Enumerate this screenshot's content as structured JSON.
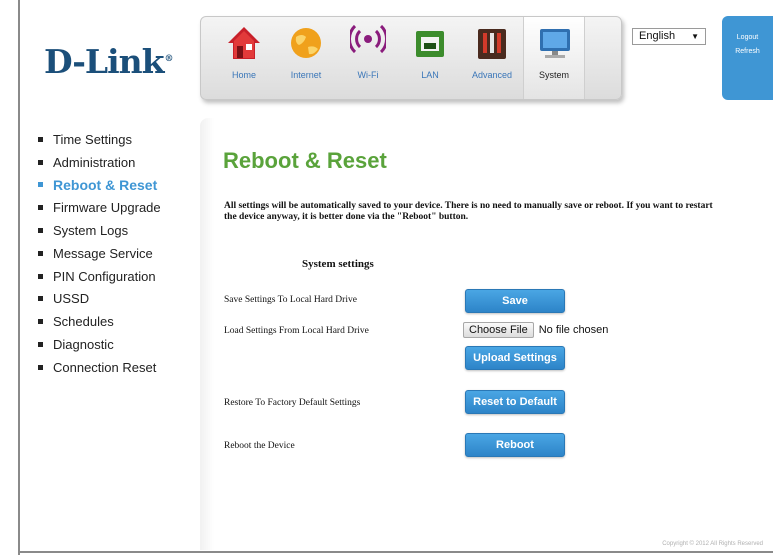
{
  "brand": {
    "logo_text": "D-Link",
    "registered": "®"
  },
  "nav": {
    "items": [
      {
        "label": "Home",
        "icon": "home-icon"
      },
      {
        "label": "Internet",
        "icon": "globe-icon"
      },
      {
        "label": "Wi-Fi",
        "icon": "wifi-icon"
      },
      {
        "label": "LAN",
        "icon": "lan-icon"
      },
      {
        "label": "Advanced",
        "icon": "tools-icon"
      },
      {
        "label": "System",
        "icon": "computer-icon"
      }
    ],
    "active": "System"
  },
  "language": {
    "selected": "English"
  },
  "account": {
    "logout": "Logout",
    "refresh": "Refresh"
  },
  "sidebar": {
    "items": [
      {
        "label": "Time Settings"
      },
      {
        "label": "Administration"
      },
      {
        "label": "Reboot & Reset"
      },
      {
        "label": "Firmware Upgrade"
      },
      {
        "label": "System Logs"
      },
      {
        "label": "Message Service"
      },
      {
        "label": "PIN Configuration"
      },
      {
        "label": "USSD"
      },
      {
        "label": "Schedules"
      },
      {
        "label": "Diagnostic"
      },
      {
        "label": "Connection Reset"
      }
    ],
    "active": "Reboot & Reset"
  },
  "page": {
    "title": "Reboot & Reset",
    "intro": "All settings will be automatically saved to your device. There is no need to manually save or reboot. If you want to restart the device anyway, it is better done via the \"Reboot\" button.",
    "section_title": "System settings",
    "rows": {
      "save_label": "Save Settings To Local Hard Drive",
      "save_button": "Save",
      "load_label": "Load Settings From Local Hard Drive",
      "choose_file": "Choose File",
      "no_file": "No file chosen",
      "upload_button": "Upload Settings",
      "restore_label": "Restore To Factory Default Settings",
      "reset_button": "Reset to Default",
      "reboot_label": "Reboot the Device",
      "reboot_button": "Reboot"
    }
  },
  "footer": {
    "copyright": "Copyright © 2012 All Rights Reserved"
  },
  "colors": {
    "accent_blue": "#3f96d4",
    "title_green": "#5aa33b",
    "logo_navy": "#1b4f7a"
  }
}
